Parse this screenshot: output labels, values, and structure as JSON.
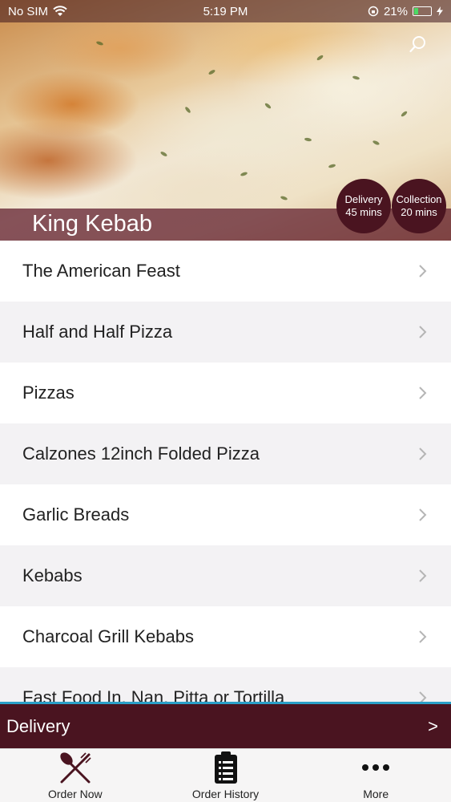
{
  "status_bar": {
    "carrier": "No SIM",
    "time": "5:19 PM",
    "battery": "21%"
  },
  "restaurant": {
    "name": "King Kebab"
  },
  "badges": {
    "delivery": {
      "label": "Delivery",
      "time": "45 mins"
    },
    "collection": {
      "label": "Collection",
      "time": "20 mins"
    }
  },
  "menu": {
    "items": [
      "The American Feast",
      "Half and Half Pizza",
      "Pizzas",
      "Calzones 12inch Folded Pizza",
      "Garlic Breads",
      "Kebabs",
      "Charcoal Grill Kebabs",
      "Fast Food In, Nan, Pitta or Tortilla"
    ]
  },
  "order_bar": {
    "mode": "Delivery",
    "arrow": ">"
  },
  "tabs": [
    {
      "label": "Order Now",
      "icon": "fork-knife-icon"
    },
    {
      "label": "Order History",
      "icon": "clipboard-list-icon"
    },
    {
      "label": "More",
      "icon": "more-dots-icon"
    }
  ],
  "colors": {
    "brand": "#4a1420",
    "accent_line": "#2aa0c8"
  }
}
